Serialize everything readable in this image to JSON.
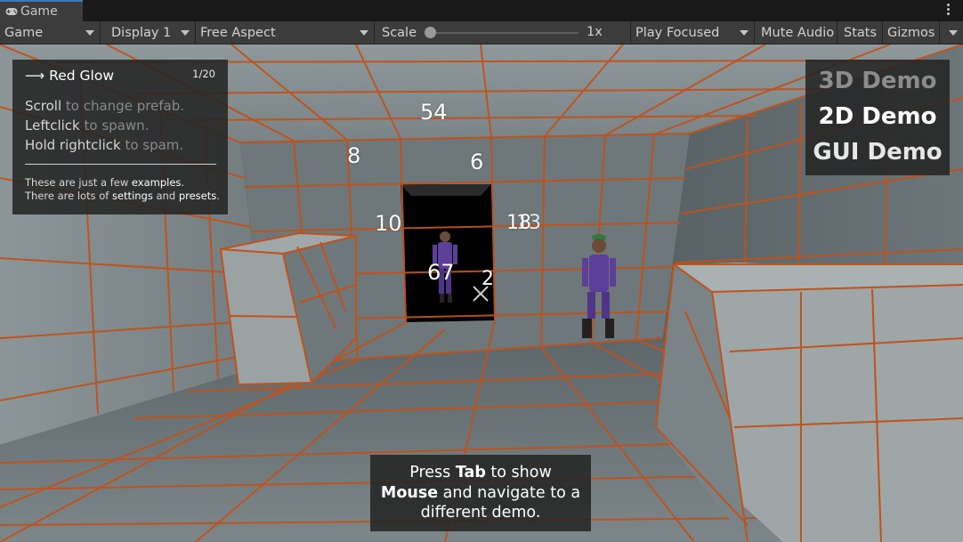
{
  "tab": {
    "label": "Game",
    "icon": "gamepad-icon"
  },
  "toolbar": {
    "view_mode": "Game",
    "display": "Display 1",
    "aspect": "Free Aspect",
    "scale_label": "Scale",
    "scale_value": "1x",
    "play_mode": "Play Focused",
    "mute": "Mute Audio",
    "stats": "Stats",
    "gizmos": "Gizmos"
  },
  "info_panel": {
    "prefab_arrow": "⟶",
    "prefab_name": "Red Glow",
    "counter": "1/20",
    "lines": [
      {
        "key": "Scroll",
        "rest": " to change prefab."
      },
      {
        "key": "Leftclick",
        "rest": " to spawn."
      },
      {
        "key": "Hold rightclick",
        "rest": " to spam."
      }
    ],
    "footer1": {
      "a": "These are just a few ",
      "b": "examples",
      "c": "."
    },
    "footer2": {
      "a": "There are lots of ",
      "b": "settings",
      "c": " and ",
      "d": "presets",
      "e": "."
    }
  },
  "demo_menu": {
    "items": [
      {
        "label": "3D Demo",
        "color": "#8c8c8c"
      },
      {
        "label": "2D Demo",
        "color": "#ffffff"
      },
      {
        "label": "GUI Demo",
        "color": "#e6e6e6"
      }
    ]
  },
  "hint": {
    "l1a": "Press ",
    "l1b": "Tab",
    "l1c": " to show",
    "l2a": "Mouse",
    "l2b": " and navigate to a",
    "l3": "different demo."
  },
  "floating_numbers": [
    "54",
    "8",
    "6",
    "10",
    "18",
    "13",
    "67",
    "2"
  ],
  "colors": {
    "grid_line": "#c0521c",
    "panel_bg": "#242424",
    "tab_accent": "#3a79bb"
  }
}
